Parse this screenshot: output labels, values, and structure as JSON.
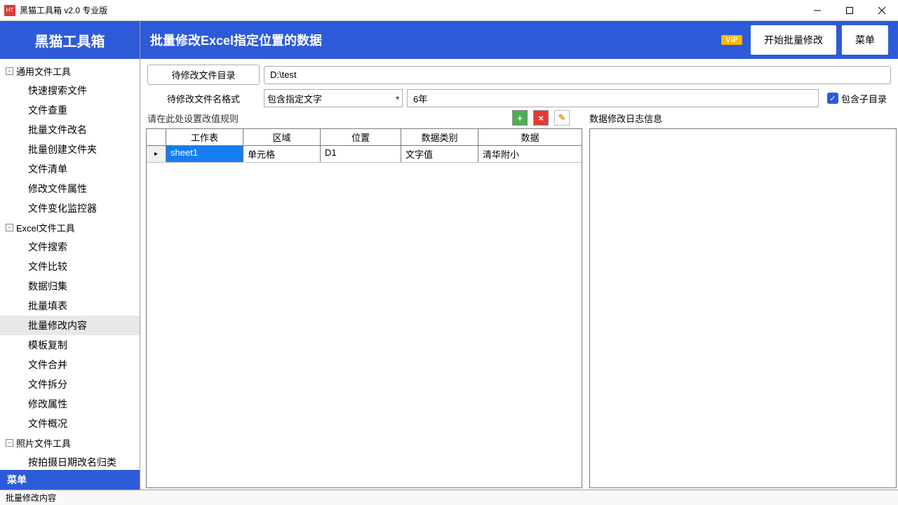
{
  "window": {
    "title": "黑猫工具箱 v2.0 专业版"
  },
  "sidebar": {
    "header": "黑猫工具箱",
    "footer": "菜单",
    "groups": [
      {
        "label": "通用文件工具",
        "items": [
          "快速搜索文件",
          "文件查重",
          "批量文件改名",
          "批量创建文件夹",
          "文件清单",
          "修改文件属性",
          "文件变化监控器"
        ]
      },
      {
        "label": "Excel文件工具",
        "items": [
          "文件搜索",
          "文件比较",
          "数据归集",
          "批量填表",
          "批量修改内容",
          "模板复制",
          "文件合并",
          "文件拆分",
          "修改属性",
          "文件概况"
        ],
        "selected_index": 4
      },
      {
        "label": "照片文件工具",
        "items": [
          "按拍摄日期改名归类"
        ]
      }
    ]
  },
  "header": {
    "title": "批量修改Excel指定位置的数据",
    "vip": "VIP",
    "start_btn": "开始批量修改",
    "menu_btn": "菜单"
  },
  "config": {
    "dir_btn": "待修改文件目录",
    "dir_value": "D:\\test",
    "fmt_label": "待修改文件名格式",
    "fmt_combo": "包含指定文字",
    "fmt_text": "6年",
    "subdir_label": "包含子目录"
  },
  "rules": {
    "hint": "请在此处设置改值规则",
    "log_title": "数据修改日志信息",
    "cols": {
      "sheet": "工作表",
      "area": "区域",
      "pos": "位置",
      "dtype": "数据类别",
      "data": "数据"
    },
    "rows": [
      {
        "sheet": "sheet1",
        "area": "单元格",
        "pos": "D1",
        "dtype": "文字值",
        "data": "清华附小"
      }
    ]
  },
  "status": {
    "text": "批量修改内容"
  }
}
